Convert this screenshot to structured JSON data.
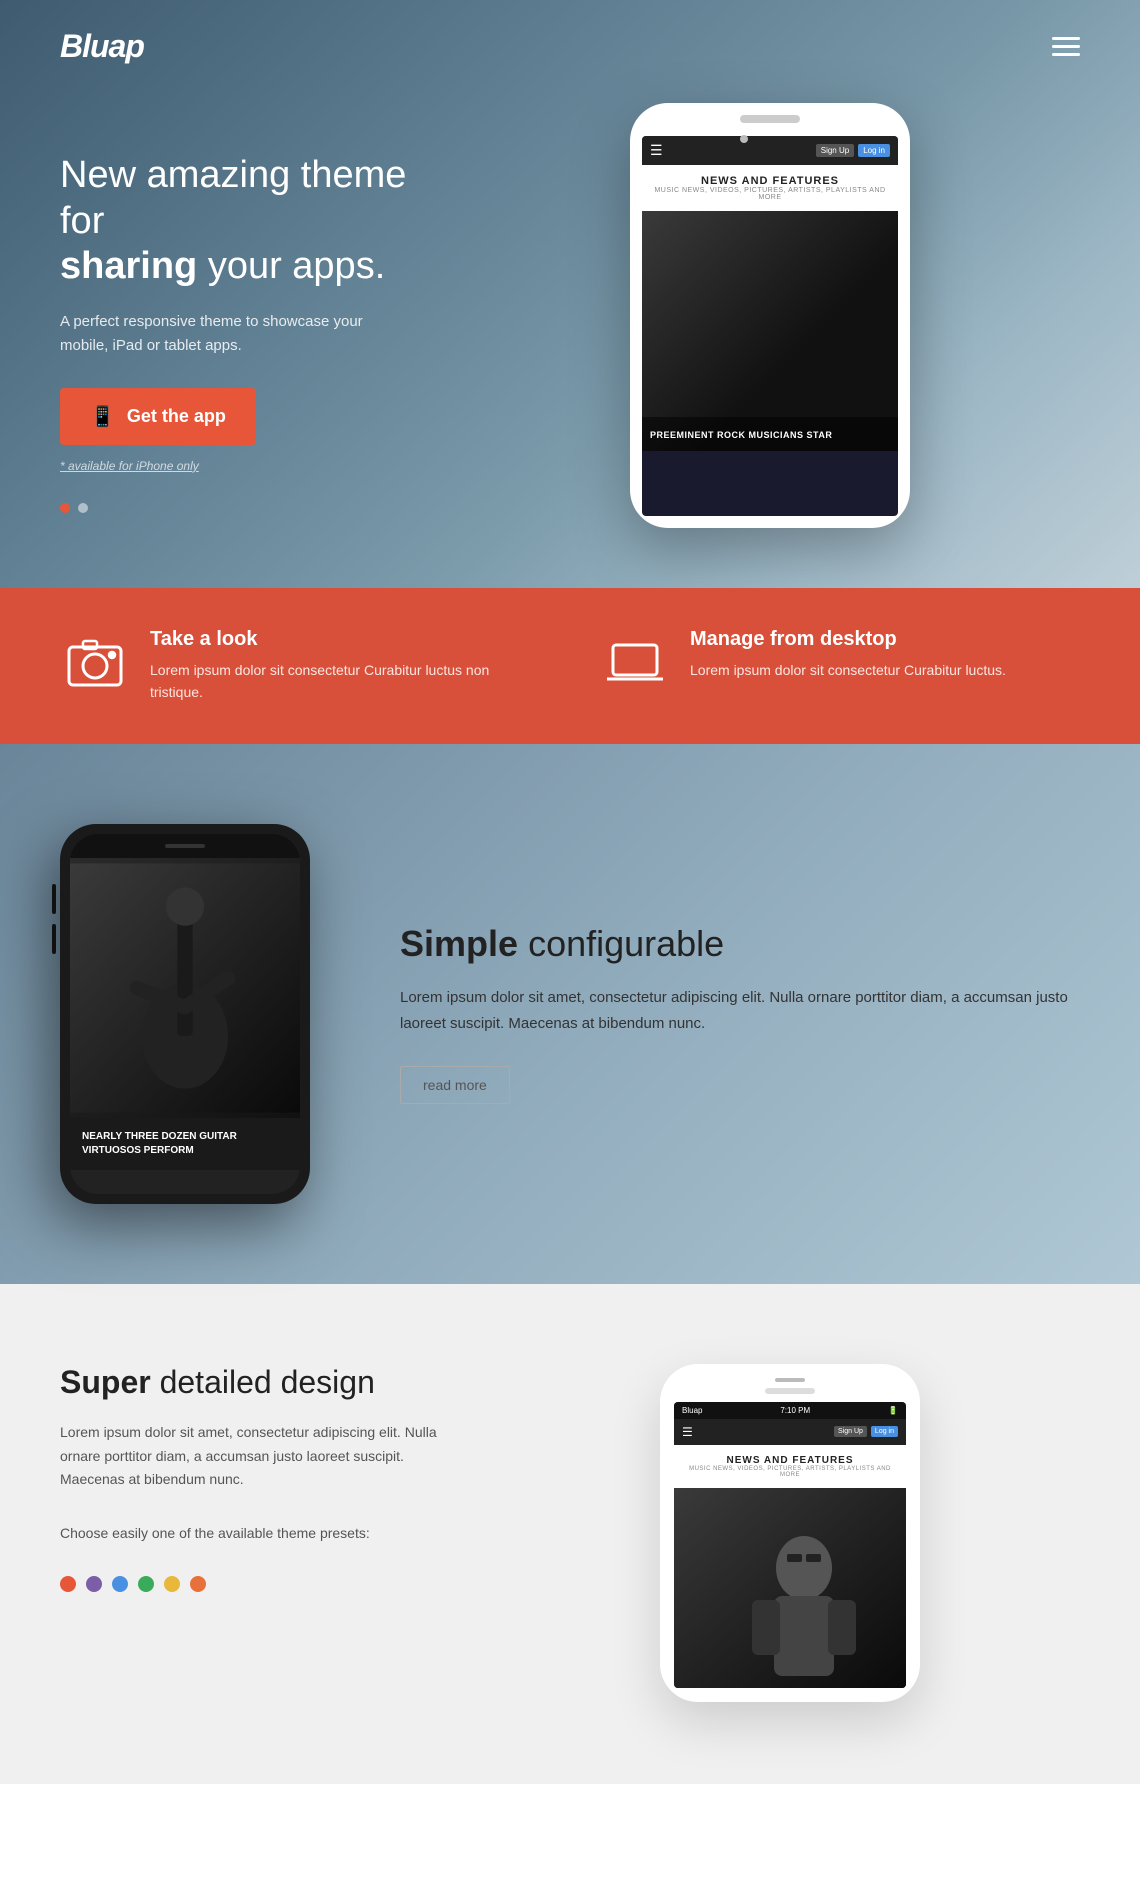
{
  "nav": {
    "logo": "Bluap",
    "hamburger_label": "Menu"
  },
  "hero": {
    "headline_normal": "New amazing theme for ",
    "headline_bold": "sharing",
    "headline_end": " your apps.",
    "description": "A perfect responsive theme to showcase your mobile, iPad or tablet apps.",
    "cta_label": "Get the app",
    "available_note": "* available for iPhone only",
    "phone_screen": {
      "title": "NEWS AND FEATURES",
      "subtitle": "MUSIC NEWS, VIDEOS, PICTURES, ARTISTS, PLAYLISTS AND MORE",
      "caption": "PREEMINENT ROCK MUSICIANS STAR"
    },
    "dots": [
      "active",
      "inactive"
    ]
  },
  "features_bar": {
    "items": [
      {
        "icon": "camera-icon",
        "title": "Take a look",
        "description": "Lorem ipsum dolor sit consectetur Curabitur luctus non tristique."
      },
      {
        "icon": "laptop-icon",
        "title": "Manage from desktop",
        "description": "Lorem ipsum dolor sit consectetur Curabitur luctus."
      }
    ]
  },
  "section_simple": {
    "heading_bold": "Simple",
    "heading_normal": " configurable",
    "description": "Lorem ipsum dolor sit amet, consectetur adipiscing elit. Nulla ornare porttitor diam, a accumsan justo laoreet suscipit. Maecenas at bibendum nunc.",
    "read_more_label": "read more",
    "phone_caption": "NEARLY THREE DOZEN GUITAR VIRTUOSOS PERFORM"
  },
  "section_super": {
    "heading_bold": "Super",
    "heading_normal": " detailed design",
    "description": "Lorem ipsum dolor sit amet, consectetur adipiscing elit. Nulla ornare porttitor diam, a accumsan justo laoreet suscipit. Maecenas at bibendum nunc.",
    "presets_label": "Choose easily one of the available theme presets:",
    "color_presets": [
      {
        "color": "#e8563a",
        "name": "red"
      },
      {
        "color": "#7b5ea7",
        "name": "purple"
      },
      {
        "color": "#4a90e2",
        "name": "blue"
      },
      {
        "color": "#3aab5a",
        "name": "green"
      },
      {
        "color": "#e8b83a",
        "name": "yellow"
      },
      {
        "color": "#e8703a",
        "name": "orange"
      }
    ],
    "phone_status": {
      "carrier": "Bluap",
      "time": "7:10 PM",
      "battery": "■"
    },
    "phone_screen": {
      "title": "NEWS AND FEATURES",
      "subtitle": "MUSIC NEWS, VIDEOS, PICTURES, ARTISTS, PLAYLISTS AND MORE"
    }
  }
}
